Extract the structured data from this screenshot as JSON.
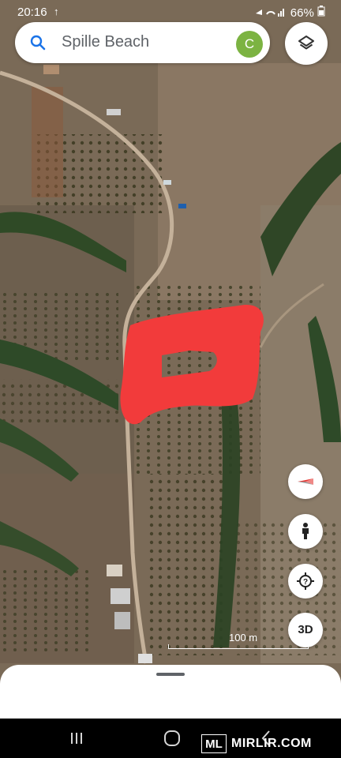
{
  "status_bar": {
    "time": "20:16",
    "upload_indicator": "↑",
    "battery": "66%"
  },
  "search": {
    "query": "Spille Beach",
    "avatar_letter": "C"
  },
  "map": {
    "scale_label": "100 m",
    "mode_3d_label": "3D"
  },
  "watermark": {
    "badge": "ML",
    "site": "MIRLIR.COM"
  },
  "colors": {
    "highlight": "#f23b3b",
    "avatar": "#7cb342",
    "compass_red": "#e53935"
  },
  "icons": [
    "search-icon",
    "layers-icon",
    "compass-icon",
    "pegman-icon",
    "help-icon",
    "back-icon",
    "home-icon",
    "recent-apps-icon"
  ]
}
